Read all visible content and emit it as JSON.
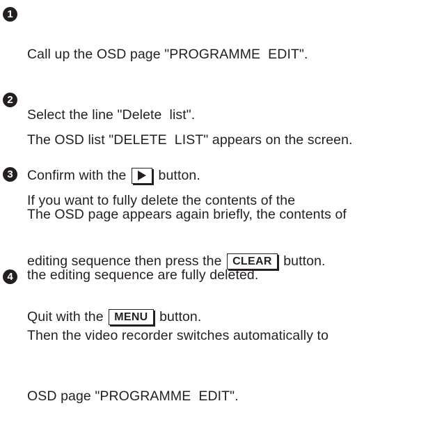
{
  "steps": [
    {
      "number": "1",
      "lines": [
        "Call up the OSD page \"PROGRAMME  EDIT\".",
        "Select the line \"Delete  list\".",
        "Confirm with the"
      ],
      "line3_suffix": "button.",
      "button_icon": "play-triangle-icon"
    },
    {
      "number": "2",
      "lines": [
        "The OSD list \"DELETE  LIST\" appears on the screen.",
        "If you want to fully delete the contents of the",
        "editing sequence then press the"
      ],
      "button_label": "CLEAR",
      "line3_suffix": "button."
    },
    {
      "number": "3",
      "lines": [
        "The OSD page appears again briefly, the contents of",
        "the editing sequence are fully deleted.",
        "Then the video recorder switches automatically to",
        "OSD page \"PROGRAMME  EDIT\"."
      ]
    },
    {
      "number": "4",
      "prefix": "Quit with the",
      "button_label": "MENU",
      "suffix": "button."
    }
  ]
}
